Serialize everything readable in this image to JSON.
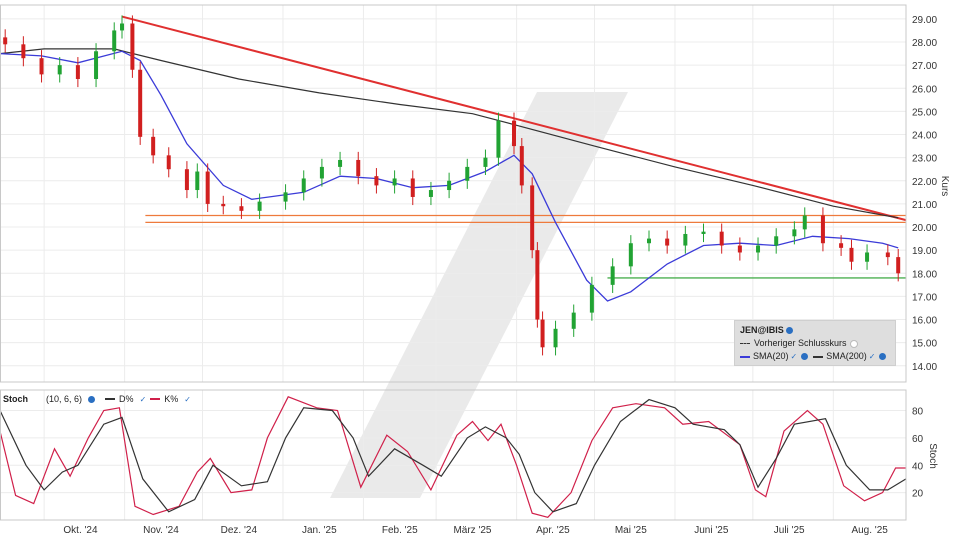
{
  "chart_data": [
    {
      "type": "candlestick",
      "title": "",
      "ylabel": "Kurs",
      "ylim": [
        13.3,
        29.6
      ],
      "yticks": [
        "29.00",
        "28.00",
        "27.00",
        "26.00",
        "25.00",
        "24.00",
        "23.00",
        "22.00",
        "21.00",
        "20.00",
        "19.00",
        "18.00",
        "17.00",
        "16.00",
        "15.00",
        "14.00"
      ],
      "x_labels": [
        "Okt. '24",
        "Nov. '24",
        "Dez. '24",
        "Jan. '25",
        "Feb. '25",
        "März '25",
        "Apr. '25",
        "Mai '25",
        "Juni '25",
        "Juli '25",
        "Aug. '25"
      ],
      "x_range": [
        "2024-09-14",
        "2025-08-29"
      ],
      "close": [
        {
          "d": "2024-09-16",
          "v": 27.9
        },
        {
          "d": "2024-09-23",
          "v": 27.3
        },
        {
          "d": "2024-09-30",
          "v": 26.6
        },
        {
          "d": "2024-10-07",
          "v": 27.0
        },
        {
          "d": "2024-10-14",
          "v": 26.4
        },
        {
          "d": "2024-10-21",
          "v": 27.6
        },
        {
          "d": "2024-10-28",
          "v": 28.5
        },
        {
          "d": "2024-10-31",
          "v": 28.8
        },
        {
          "d": "2024-11-04",
          "v": 26.8
        },
        {
          "d": "2024-11-07",
          "v": 23.9
        },
        {
          "d": "2024-11-12",
          "v": 23.1
        },
        {
          "d": "2024-11-18",
          "v": 22.5
        },
        {
          "d": "2024-11-25",
          "v": 21.6
        },
        {
          "d": "2024-11-29",
          "v": 22.4
        },
        {
          "d": "2024-12-03",
          "v": 21.0
        },
        {
          "d": "2024-12-09",
          "v": 20.9
        },
        {
          "d": "2024-12-16",
          "v": 20.7
        },
        {
          "d": "2024-12-23",
          "v": 21.1
        },
        {
          "d": "2025-01-02",
          "v": 21.5
        },
        {
          "d": "2025-01-09",
          "v": 22.1
        },
        {
          "d": "2025-01-16",
          "v": 22.6
        },
        {
          "d": "2025-01-23",
          "v": 22.9
        },
        {
          "d": "2025-01-30",
          "v": 22.2
        },
        {
          "d": "2025-02-06",
          "v": 21.8
        },
        {
          "d": "2025-02-13",
          "v": 22.1
        },
        {
          "d": "2025-02-20",
          "v": 21.3
        },
        {
          "d": "2025-02-27",
          "v": 21.6
        },
        {
          "d": "2025-03-06",
          "v": 22.0
        },
        {
          "d": "2025-03-13",
          "v": 22.6
        },
        {
          "d": "2025-03-20",
          "v": 23.0
        },
        {
          "d": "2025-03-25",
          "v": 24.6
        },
        {
          "d": "2025-03-31",
          "v": 23.5
        },
        {
          "d": "2025-04-03",
          "v": 21.8
        },
        {
          "d": "2025-04-07",
          "v": 19.0
        },
        {
          "d": "2025-04-09",
          "v": 16.0
        },
        {
          "d": "2025-04-11",
          "v": 14.8
        },
        {
          "d": "2025-04-16",
          "v": 15.6
        },
        {
          "d": "2025-04-23",
          "v": 16.3
        },
        {
          "d": "2025-04-30",
          "v": 17.5
        },
        {
          "d": "2025-05-08",
          "v": 18.3
        },
        {
          "d": "2025-05-15",
          "v": 19.3
        },
        {
          "d": "2025-05-22",
          "v": 19.5
        },
        {
          "d": "2025-05-29",
          "v": 19.2
        },
        {
          "d": "2025-06-05",
          "v": 19.7
        },
        {
          "d": "2025-06-12",
          "v": 19.8
        },
        {
          "d": "2025-06-19",
          "v": 19.2
        },
        {
          "d": "2025-06-26",
          "v": 18.9
        },
        {
          "d": "2025-07-03",
          "v": 19.2
        },
        {
          "d": "2025-07-10",
          "v": 19.6
        },
        {
          "d": "2025-07-17",
          "v": 19.9
        },
        {
          "d": "2025-07-21",
          "v": 20.5
        },
        {
          "d": "2025-07-28",
          "v": 19.3
        },
        {
          "d": "2025-08-04",
          "v": 19.1
        },
        {
          "d": "2025-08-08",
          "v": 18.5
        },
        {
          "d": "2025-08-14",
          "v": 18.9
        },
        {
          "d": "2025-08-22",
          "v": 18.7
        },
        {
          "d": "2025-08-26",
          "v": 18.0
        }
      ],
      "sma20": [
        {
          "d": "2024-09-14",
          "v": 27.5
        },
        {
          "d": "2024-09-30",
          "v": 27.4
        },
        {
          "d": "2024-10-14",
          "v": 27.1
        },
        {
          "d": "2024-10-31",
          "v": 27.6
        },
        {
          "d": "2024-11-07",
          "v": 27.2
        },
        {
          "d": "2024-11-15",
          "v": 25.7
        },
        {
          "d": "2024-11-25",
          "v": 23.6
        },
        {
          "d": "2024-12-09",
          "v": 21.8
        },
        {
          "d": "2024-12-20",
          "v": 21.2
        },
        {
          "d": "2025-01-09",
          "v": 21.5
        },
        {
          "d": "2025-01-23",
          "v": 22.2
        },
        {
          "d": "2025-02-06",
          "v": 22.1
        },
        {
          "d": "2025-02-20",
          "v": 21.7
        },
        {
          "d": "2025-03-06",
          "v": 21.8
        },
        {
          "d": "2025-03-20",
          "v": 22.4
        },
        {
          "d": "2025-03-31",
          "v": 23.1
        },
        {
          "d": "2025-04-07",
          "v": 22.3
        },
        {
          "d": "2025-04-16",
          "v": 20.2
        },
        {
          "d": "2025-04-28",
          "v": 17.7
        },
        {
          "d": "2025-05-06",
          "v": 16.8
        },
        {
          "d": "2025-05-15",
          "v": 17.2
        },
        {
          "d": "2025-05-29",
          "v": 18.4
        },
        {
          "d": "2025-06-12",
          "v": 19.2
        },
        {
          "d": "2025-06-26",
          "v": 19.3
        },
        {
          "d": "2025-07-10",
          "v": 19.2
        },
        {
          "d": "2025-07-24",
          "v": 19.6
        },
        {
          "d": "2025-08-07",
          "v": 19.5
        },
        {
          "d": "2025-08-20",
          "v": 19.3
        },
        {
          "d": "2025-08-26",
          "v": 19.1
        }
      ],
      "sma200": [
        {
          "d": "2024-09-14",
          "v": 27.5
        },
        {
          "d": "2024-10-01",
          "v": 27.7
        },
        {
          "d": "2024-10-28",
          "v": 27.7
        },
        {
          "d": "2024-11-15",
          "v": 27.2
        },
        {
          "d": "2024-12-15",
          "v": 26.4
        },
        {
          "d": "2025-01-15",
          "v": 25.8
        },
        {
          "d": "2025-02-15",
          "v": 25.3
        },
        {
          "d": "2025-03-15",
          "v": 24.9
        },
        {
          "d": "2025-04-01",
          "v": 24.4
        },
        {
          "d": "2025-05-01",
          "v": 23.5
        },
        {
          "d": "2025-06-01",
          "v": 22.6
        },
        {
          "d": "2025-07-01",
          "v": 21.8
        },
        {
          "d": "2025-08-01",
          "v": 20.9
        },
        {
          "d": "2025-08-26",
          "v": 20.4
        }
      ],
      "trendline": [
        {
          "d": "2024-10-31",
          "v": 29.1
        },
        {
          "d": "2025-08-29",
          "v": 20.3
        }
      ],
      "resistance_levels": [
        20.5,
        20.2
      ],
      "support_level": {
        "from": "2025-05-06",
        "to": "2025-08-29",
        "v": 17.8
      },
      "legend": {
        "symbol": "JEN@IBIS",
        "prev_close": "Vorheriger Schlusskurs",
        "sma20": "SMA(20)",
        "sma200": "SMA(200)"
      },
      "colors": {
        "up": "#21a333",
        "down": "#d11f1f",
        "sma20": "#3b3bd8",
        "sma200": "#333333",
        "trend": "#e03030",
        "resistance": "#ee7a3c",
        "support": "#4caf50"
      }
    },
    {
      "type": "line",
      "title": "Stoch",
      "params": "(10, 6, 6)",
      "ylabel": "Stoch",
      "ylim": [
        0,
        95
      ],
      "yticks": [
        "80",
        "60",
        "40",
        "20"
      ],
      "series": [
        {
          "name": "D%",
          "color": "#333333",
          "points": [
            {
              "d": "2024-09-14",
              "v": 80
            },
            {
              "d": "2024-09-24",
              "v": 40
            },
            {
              "d": "2024-10-01",
              "v": 22
            },
            {
              "d": "2024-10-08",
              "v": 35
            },
            {
              "d": "2024-10-14",
              "v": 40
            },
            {
              "d": "2024-10-24",
              "v": 70
            },
            {
              "d": "2024-10-31",
              "v": 75
            },
            {
              "d": "2024-11-08",
              "v": 30
            },
            {
              "d": "2024-11-18",
              "v": 6
            },
            {
              "d": "2024-11-28",
              "v": 15
            },
            {
              "d": "2024-12-05",
              "v": 40
            },
            {
              "d": "2024-12-16",
              "v": 25
            },
            {
              "d": "2024-12-26",
              "v": 28
            },
            {
              "d": "2025-01-02",
              "v": 60
            },
            {
              "d": "2025-01-09",
              "v": 82
            },
            {
              "d": "2025-01-20",
              "v": 80
            },
            {
              "d": "2025-01-28",
              "v": 60
            },
            {
              "d": "2025-02-03",
              "v": 32
            },
            {
              "d": "2025-02-13",
              "v": 52
            },
            {
              "d": "2025-02-24",
              "v": 40
            },
            {
              "d": "2025-03-03",
              "v": 32
            },
            {
              "d": "2025-03-13",
              "v": 60
            },
            {
              "d": "2025-03-20",
              "v": 68
            },
            {
              "d": "2025-03-28",
              "v": 60
            },
            {
              "d": "2025-04-02",
              "v": 48
            },
            {
              "d": "2025-04-08",
              "v": 20
            },
            {
              "d": "2025-04-15",
              "v": 6
            },
            {
              "d": "2025-04-24",
              "v": 12
            },
            {
              "d": "2025-05-01",
              "v": 40
            },
            {
              "d": "2025-05-11",
              "v": 72
            },
            {
              "d": "2025-05-22",
              "v": 88
            },
            {
              "d": "2025-06-01",
              "v": 82
            },
            {
              "d": "2025-06-08",
              "v": 70
            },
            {
              "d": "2025-06-20",
              "v": 66
            },
            {
              "d": "2025-06-26",
              "v": 55
            },
            {
              "d": "2025-07-03",
              "v": 24
            },
            {
              "d": "2025-07-10",
              "v": 45
            },
            {
              "d": "2025-07-17",
              "v": 70
            },
            {
              "d": "2025-07-29",
              "v": 74
            },
            {
              "d": "2025-08-06",
              "v": 40
            },
            {
              "d": "2025-08-15",
              "v": 22
            },
            {
              "d": "2025-08-22",
              "v": 22
            },
            {
              "d": "2025-08-29",
              "v": 30
            }
          ]
        },
        {
          "name": "K%",
          "color": "#d0204a",
          "points": [
            {
              "d": "2024-09-14",
              "v": 65
            },
            {
              "d": "2024-09-20",
              "v": 18
            },
            {
              "d": "2024-09-27",
              "v": 12
            },
            {
              "d": "2024-10-05",
              "v": 52
            },
            {
              "d": "2024-10-11",
              "v": 32
            },
            {
              "d": "2024-10-18",
              "v": 60
            },
            {
              "d": "2024-10-24",
              "v": 80
            },
            {
              "d": "2024-10-30",
              "v": 82
            },
            {
              "d": "2024-11-05",
              "v": 10
            },
            {
              "d": "2024-11-12",
              "v": 4
            },
            {
              "d": "2024-11-22",
              "v": 10
            },
            {
              "d": "2024-11-29",
              "v": 35
            },
            {
              "d": "2024-12-04",
              "v": 45
            },
            {
              "d": "2024-12-12",
              "v": 20
            },
            {
              "d": "2024-12-20",
              "v": 22
            },
            {
              "d": "2024-12-26",
              "v": 60
            },
            {
              "d": "2025-01-03",
              "v": 90
            },
            {
              "d": "2025-01-14",
              "v": 82
            },
            {
              "d": "2025-01-22",
              "v": 80
            },
            {
              "d": "2025-01-31",
              "v": 24
            },
            {
              "d": "2025-02-10",
              "v": 62
            },
            {
              "d": "2025-02-18",
              "v": 50
            },
            {
              "d": "2025-02-27",
              "v": 22
            },
            {
              "d": "2025-03-09",
              "v": 62
            },
            {
              "d": "2025-03-15",
              "v": 72
            },
            {
              "d": "2025-03-21",
              "v": 58
            },
            {
              "d": "2025-03-26",
              "v": 70
            },
            {
              "d": "2025-04-01",
              "v": 40
            },
            {
              "d": "2025-04-07",
              "v": 5
            },
            {
              "d": "2025-04-13",
              "v": 2
            },
            {
              "d": "2025-04-22",
              "v": 20
            },
            {
              "d": "2025-04-30",
              "v": 58
            },
            {
              "d": "2025-05-08",
              "v": 82
            },
            {
              "d": "2025-05-17",
              "v": 85
            },
            {
              "d": "2025-05-28",
              "v": 82
            },
            {
              "d": "2025-06-04",
              "v": 70
            },
            {
              "d": "2025-06-14",
              "v": 72
            },
            {
              "d": "2025-06-26",
              "v": 55
            },
            {
              "d": "2025-07-02",
              "v": 22
            },
            {
              "d": "2025-07-06",
              "v": 17
            },
            {
              "d": "2025-07-13",
              "v": 65
            },
            {
              "d": "2025-07-22",
              "v": 80
            },
            {
              "d": "2025-07-28",
              "v": 70
            },
            {
              "d": "2025-08-05",
              "v": 25
            },
            {
              "d": "2025-08-13",
              "v": 14
            },
            {
              "d": "2025-08-20",
              "v": 20
            },
            {
              "d": "2025-08-25",
              "v": 38
            },
            {
              "d": "2025-08-29",
              "v": 38
            }
          ]
        }
      ]
    }
  ]
}
